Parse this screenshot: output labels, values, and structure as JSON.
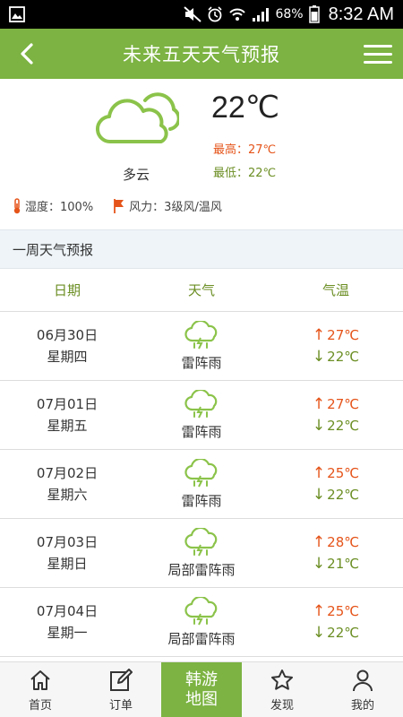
{
  "status": {
    "battery_pct": "68%",
    "time": "8:32 AM"
  },
  "header": {
    "title": "未来五天天气预报"
  },
  "current": {
    "temp": "22℃",
    "condition": "多云",
    "high": "最高：27℃",
    "low": "最低：22℃",
    "humidity": "湿度：100%",
    "wind": "风力：3级风/温风"
  },
  "section": {
    "title": "一周天气预报"
  },
  "table": {
    "headers": [
      "日期",
      "天气",
      "气温"
    ],
    "rows": [
      {
        "date": "06月30日",
        "weekday": "星期四",
        "weather": "雷阵雨",
        "high": "27℃",
        "low": "22℃"
      },
      {
        "date": "07月01日",
        "weekday": "星期五",
        "weather": "雷阵雨",
        "high": "27℃",
        "low": "22℃"
      },
      {
        "date": "07月02日",
        "weekday": "星期六",
        "weather": "雷阵雨",
        "high": "25℃",
        "low": "22℃"
      },
      {
        "date": "07月03日",
        "weekday": "星期日",
        "weather": "局部雷阵雨",
        "high": "28℃",
        "low": "21℃"
      },
      {
        "date": "07月04日",
        "weekday": "星期一",
        "weather": "局部雷阵雨",
        "high": "25℃",
        "low": "22℃"
      }
    ]
  },
  "nav": {
    "home": "首页",
    "orders": "订单",
    "center_line1": "韩游",
    "center_line2": "地图",
    "discover": "发现",
    "mine": "我的"
  },
  "colors": {
    "brand_green": "#7cb342",
    "high_temp": "#e5541a",
    "low_temp": "#6b8e23"
  }
}
